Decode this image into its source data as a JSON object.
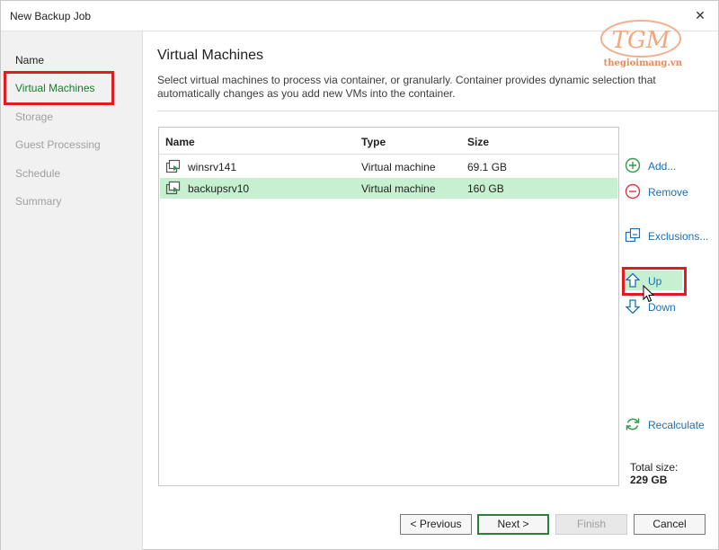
{
  "window": {
    "title": "New Backup Job"
  },
  "watermark": {
    "text": "thegioimang.vn"
  },
  "wizard_steps": [
    {
      "label": "Name",
      "state": "enabled"
    },
    {
      "label": "Virtual Machines",
      "state": "current"
    },
    {
      "label": "Storage",
      "state": "disabled"
    },
    {
      "label": "Guest Processing",
      "state": "disabled"
    },
    {
      "label": "Schedule",
      "state": "disabled"
    },
    {
      "label": "Summary",
      "state": "disabled"
    }
  ],
  "page": {
    "title": "Virtual Machines",
    "description": "Select virtual machines to process via container, or granularly. Container provides dynamic selection that automatically changes as you add new VMs into the container."
  },
  "table": {
    "columns": [
      "Name",
      "Type",
      "Size"
    ],
    "rows": [
      {
        "name": "winsrv141",
        "type": "Virtual machine",
        "size": "69.1 GB",
        "selected": false
      },
      {
        "name": "backupsrv10",
        "type": "Virtual machine",
        "size": "160 GB",
        "selected": true
      }
    ]
  },
  "actions": {
    "add": "Add...",
    "remove": "Remove",
    "exclusions": "Exclusions...",
    "up": "Up",
    "down": "Down",
    "recalculate": "Recalculate"
  },
  "totals": {
    "label": "Total size:",
    "value": "229 GB"
  },
  "footer": {
    "previous": "< Previous",
    "next": "Next >",
    "finish": "Finish",
    "cancel": "Cancel"
  },
  "colors": {
    "accent_green": "#1b7a2f",
    "selection_green": "#c6f0cf",
    "annotation_red": "#e21b23",
    "link_blue": "#1b6fb5"
  }
}
